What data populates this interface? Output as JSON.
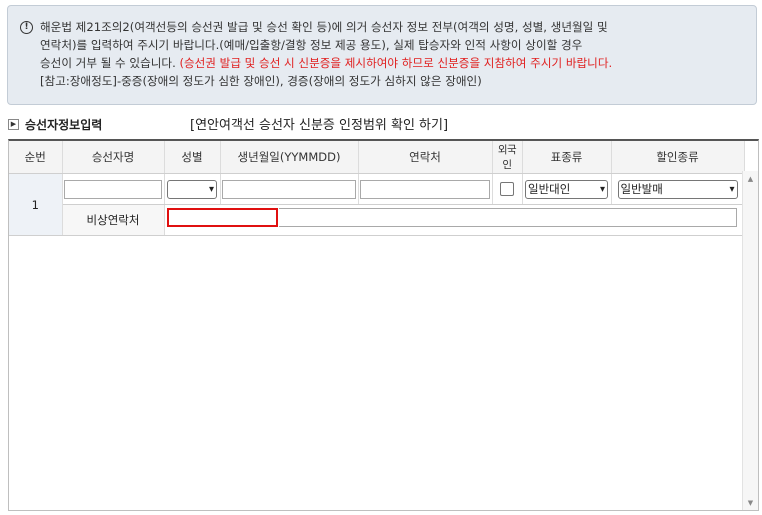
{
  "notice": {
    "line1": "해운법 제21조의2(여객선등의 승선권 발급 및 승선 확인 등)에 의거 승선자 정보 전부(여객의 성명, 성별, 생년월일 및",
    "line2": "연락처)를 입력하여 주시기 바랍니다.(예매/입출항/결항 정보 제공 용도), 실제 탑승자와 인적 사항이 상이할 경우",
    "line3a": "승선이 거부 될 수 있습니다. ",
    "line3b": "(승선권 발급 및 승선 시 신분증을 제시하여야 하므로 신분증을 지참하여 주시기 바랍니다.",
    "line4": "[참고:장애정도]-중증(장애의 정도가 심한 장애인), 경증(장애의 정도가 심하지 않은 장애인)"
  },
  "section": {
    "title": "승선자정보입력",
    "link": "[연안여객선 승선자 신분증 인정범위 확인 하기]"
  },
  "columns": [
    "순번",
    "승선자명",
    "성별",
    "생년월일(YYMMDD)",
    "연락처",
    "외국인",
    "표종류",
    "할인종류"
  ],
  "row": {
    "number": "1",
    "gender": "",
    "ticket_type": "일반대인",
    "discount_type": "일반발매",
    "emergency_label": "비상연락처"
  }
}
